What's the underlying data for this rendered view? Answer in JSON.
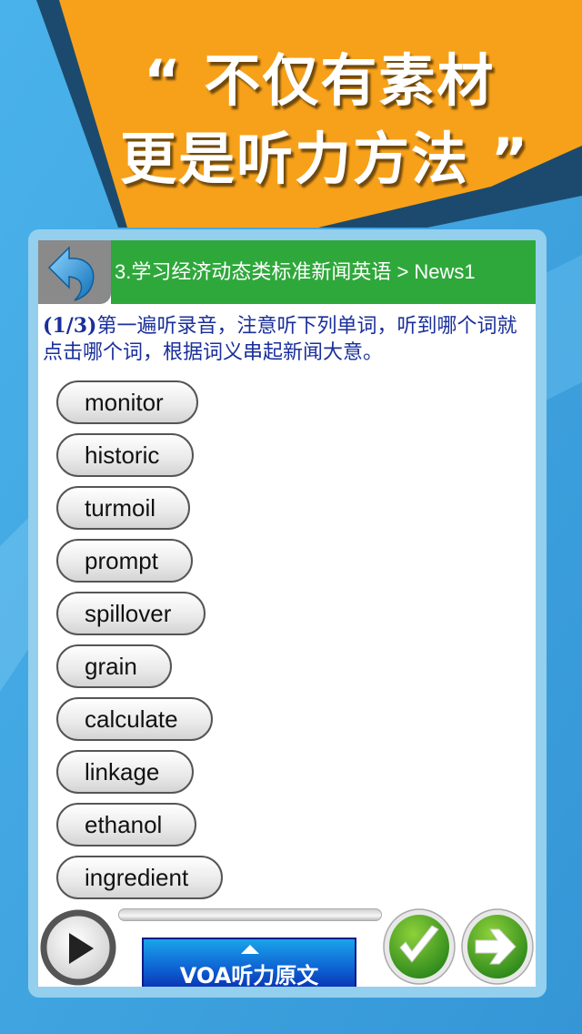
{
  "banner": {
    "line1": "“ 不仅有素材",
    "line2": "更是听力方法 ”"
  },
  "header": {
    "back_icon": "back-arrow-icon",
    "breadcrumb": "3.学习经济动态类标准新闻英语 > News1"
  },
  "instruction": {
    "step": "(1/3)",
    "text": "第一遍听录音，注意听下列单词，听到哪个词就点击哪个词，根据词义串起新闻大意。"
  },
  "words": [
    {
      "label": "monitor"
    },
    {
      "label": "historic"
    },
    {
      "label": "turmoil"
    },
    {
      "label": "prompt"
    },
    {
      "label": "spillover"
    },
    {
      "label": "grain"
    },
    {
      "label": "calculate"
    },
    {
      "label": "linkage"
    },
    {
      "label": "ethanol"
    },
    {
      "label": "ingredient"
    }
  ],
  "player": {
    "play_icon": "play-icon",
    "progress": 0,
    "transcript_button": "VOA听力原文",
    "check_icon": "checkmark-icon",
    "next_icon": "arrow-right-icon"
  },
  "colors": {
    "background_blue": "#3ea6e2",
    "banner_orange": "#f7a11a",
    "banner_dark": "#1c4a6e",
    "title_green": "#2fa83b",
    "instruction_blue": "#1a2f9a"
  }
}
